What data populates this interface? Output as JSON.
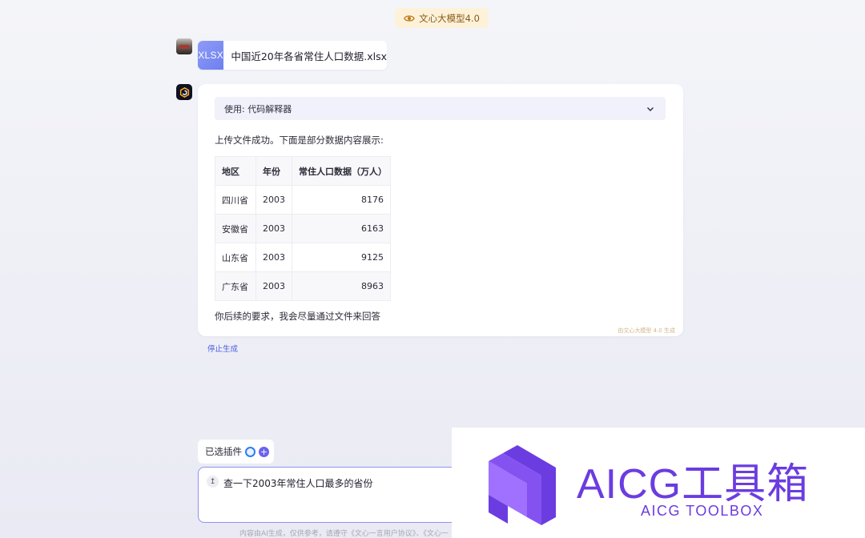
{
  "model_badge": {
    "label": "文心大模型4.0"
  },
  "file": {
    "type": "XLSX",
    "name": "中国近20年各省常住人口数据.xlsx"
  },
  "answer": {
    "plugin_bar": "使用: 代码解释器",
    "intro": "上传文件成功。下面是部分数据内容展示:",
    "table": {
      "headers": [
        "地区",
        "年份",
        "常住人口数据（万人）"
      ],
      "rows": [
        [
          "四川省",
          "2003",
          "8176"
        ],
        [
          "安徽省",
          "2003",
          "6163"
        ],
        [
          "山东省",
          "2003",
          "9125"
        ],
        [
          "广东省",
          "2003",
          "8963"
        ]
      ]
    },
    "outro": "你后续的要求，我会尽量通过文件来回答",
    "gen_tag": "由文心大模型 4.0 生成"
  },
  "stop_label": "停止生成",
  "plugins": {
    "label": "已选插件"
  },
  "input": {
    "value": "查一下2003年常住人口最多的省份"
  },
  "disclaimer": "内容由AI生成，仅供参考，请遵守《文心一言用户协议》、《文心一",
  "watermark": {
    "title": "AICG工具箱",
    "subtitle": "AICG TOOLBOX"
  },
  "colors": {
    "accent": "#6b3ce0",
    "link": "#4a5ee5",
    "badge_bg": "#fdf2d9"
  }
}
